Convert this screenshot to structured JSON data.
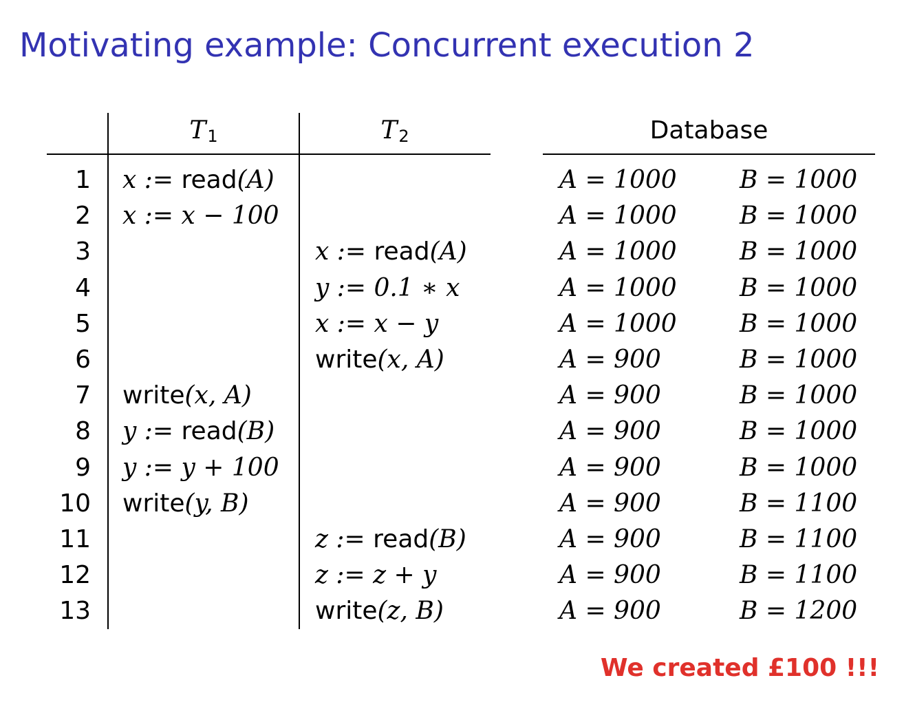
{
  "slide": {
    "title": "Motivating example: Concurrent execution 2",
    "note": "We created £100 !!!",
    "title_color": "#3333b2",
    "note_color": "#e0312b"
  },
  "table": {
    "headers": {
      "t1_base": "T",
      "t1_sub": "1",
      "t2_base": "T",
      "t2_sub": "2",
      "database": "Database"
    },
    "rows": [
      {
        "n": "1",
        "t1": [
          "x := ",
          "read",
          "(A)"
        ],
        "t2": [],
        "a": "A = 1000",
        "b": "B = 1000"
      },
      {
        "n": "2",
        "t1": [
          "x := x − 100"
        ],
        "t2": [],
        "a": "A = 1000",
        "b": "B = 1000"
      },
      {
        "n": "3",
        "t1": [],
        "t2": [
          "x := ",
          "read",
          "(A)"
        ],
        "a": "A = 1000",
        "b": "B = 1000"
      },
      {
        "n": "4",
        "t1": [],
        "t2": [
          "y := 0.1 ∗ x"
        ],
        "a": "A = 1000",
        "b": "B = 1000"
      },
      {
        "n": "5",
        "t1": [],
        "t2": [
          "x := x − y"
        ],
        "a": "A = 1000",
        "b": "B = 1000"
      },
      {
        "n": "6",
        "t1": [],
        "t2": [
          "",
          "write",
          "(x, A)"
        ],
        "a": "A = 900",
        "b": "B = 1000"
      },
      {
        "n": "7",
        "t1": [
          "",
          "write",
          "(x, A)"
        ],
        "t2": [],
        "a": "A = 900",
        "b": "B = 1000"
      },
      {
        "n": "8",
        "t1": [
          "y := ",
          "read",
          "(B)"
        ],
        "t2": [],
        "a": "A = 900",
        "b": "B = 1000"
      },
      {
        "n": "9",
        "t1": [
          "y := y + 100"
        ],
        "t2": [],
        "a": "A = 900",
        "b": "B = 1000"
      },
      {
        "n": "10",
        "t1": [
          "",
          "write",
          "(y, B)"
        ],
        "t2": [],
        "a": "A = 900",
        "b": "B = 1100"
      },
      {
        "n": "11",
        "t1": [],
        "t2": [
          "z := ",
          "read",
          "(B)"
        ],
        "a": "A = 900",
        "b": "B = 1100"
      },
      {
        "n": "12",
        "t1": [],
        "t2": [
          "z := z + y"
        ],
        "a": "A = 900",
        "b": "B = 1100"
      },
      {
        "n": "13",
        "t1": [],
        "t2": [
          "",
          "write",
          "(z, B)"
        ],
        "a": "A = 900",
        "b": "B = 1200"
      }
    ]
  }
}
